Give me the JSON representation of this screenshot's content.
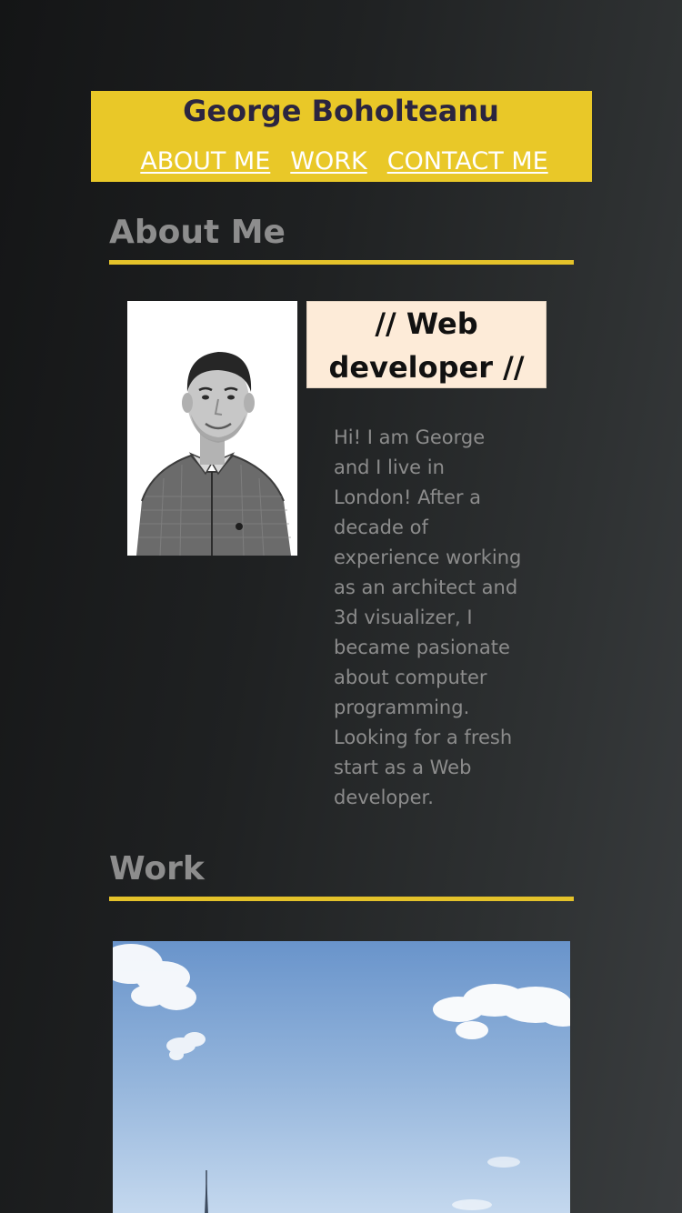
{
  "header": {
    "title": "George Boholteanu",
    "nav": [
      {
        "label": "ABOUT ME"
      },
      {
        "label": "WORK"
      },
      {
        "label": "CONTACT ME"
      }
    ]
  },
  "about": {
    "heading": "About Me",
    "role": "// Web developer //",
    "bio": "Hi! I am George and I live in London! After a decade of experience working as an architect and 3d visualizer, I became pasionate about computer programming. Looking for a fresh start as a Web developer."
  },
  "work": {
    "heading": "Work"
  },
  "colors": {
    "accent": "#e9c828",
    "heading_text": "#8d8d8d",
    "role_box": "#fdebd8"
  }
}
